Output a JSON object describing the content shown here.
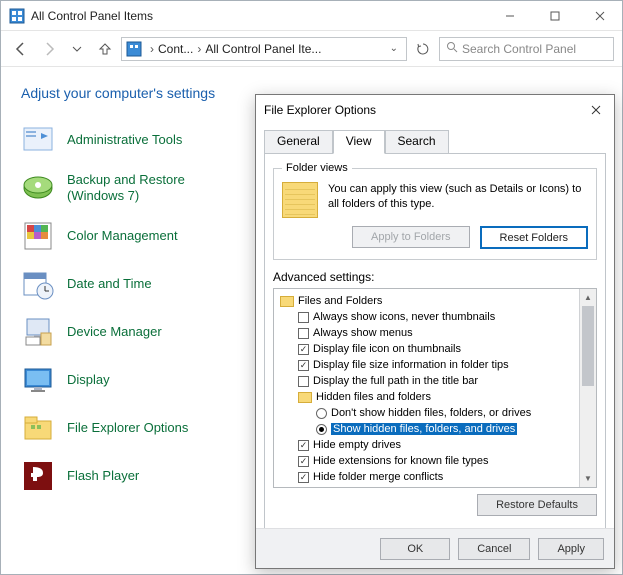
{
  "window": {
    "title": "All Control Panel Items"
  },
  "breadcrumb": {
    "part1": "Cont...",
    "part2": "All Control Panel Ite..."
  },
  "search": {
    "placeholder": "Search Control Panel"
  },
  "heading": "Adjust your computer's settings",
  "items": [
    {
      "label": "Administrative Tools"
    },
    {
      "label": "Backup and Restore"
    },
    {
      "label2": "(Windows 7)"
    },
    {
      "label": "Color Management"
    },
    {
      "label": "Date and Time"
    },
    {
      "label": "Device Manager"
    },
    {
      "label": "Display"
    },
    {
      "label": "File Explorer Options"
    },
    {
      "label": "Flash Player"
    }
  ],
  "dialog": {
    "title": "File Explorer Options",
    "tabs": {
      "general": "General",
      "view": "View",
      "search": "Search"
    },
    "folderViews": {
      "legend": "Folder views",
      "text": "You can apply this view (such as Details or Icons) to all folders of this type.",
      "applyBtn": "Apply to Folders",
      "resetBtn": "Reset Folders"
    },
    "advLabel": "Advanced settings:",
    "tree": {
      "root": "Files and Folders",
      "r1": "Always show icons, never thumbnails",
      "r2": "Always show menus",
      "r3": "Display file icon on thumbnails",
      "r4": "Display file size information in folder tips",
      "r5": "Display the full path in the title bar",
      "grp": "Hidden files and folders",
      "opt1": "Don't show hidden files, folders, or drives",
      "opt2": "Show hidden files, folders, and drives",
      "r6": "Hide empty drives",
      "r7": "Hide extensions for known file types",
      "r8": "Hide folder merge conflicts"
    },
    "restoreBtn": "Restore Defaults",
    "ok": "OK",
    "cancel": "Cancel",
    "apply": "Apply"
  }
}
